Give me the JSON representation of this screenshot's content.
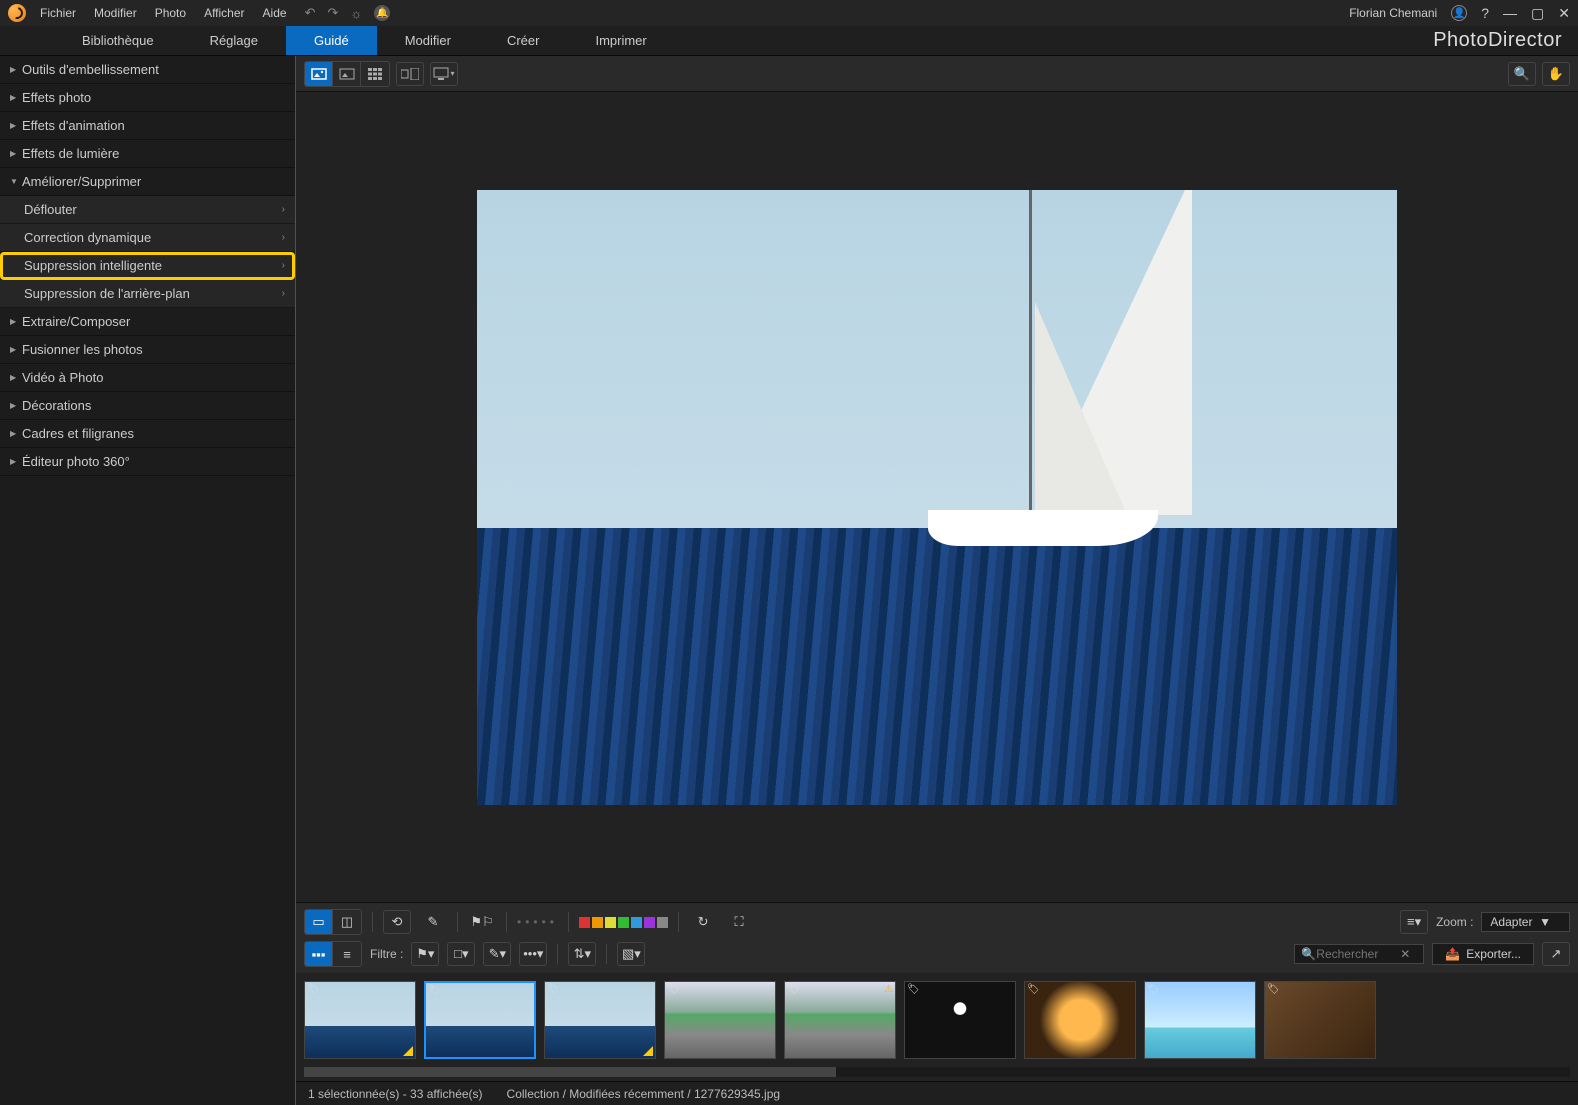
{
  "app": {
    "brand": "PhotoDirector"
  },
  "menubar": [
    "Fichier",
    "Modifier",
    "Photo",
    "Afficher",
    "Aide"
  ],
  "user": {
    "name": "Florian Chemani"
  },
  "tabs": [
    {
      "label": "Bibliothèque",
      "active": false
    },
    {
      "label": "Réglage",
      "active": false
    },
    {
      "label": "Guidé",
      "active": true
    },
    {
      "label": "Modifier",
      "active": false
    },
    {
      "label": "Créer",
      "active": false
    },
    {
      "label": "Imprimer",
      "active": false
    }
  ],
  "sidebar": [
    {
      "label": "Outils d'embellissement",
      "expanded": false
    },
    {
      "label": "Effets photo",
      "expanded": false
    },
    {
      "label": "Effets d'animation",
      "expanded": false
    },
    {
      "label": "Effets de lumière",
      "expanded": false
    },
    {
      "label": "Améliorer/Supprimer",
      "expanded": true,
      "children": [
        {
          "label": "Déflouter"
        },
        {
          "label": "Correction dynamique"
        },
        {
          "label": "Suppression intelligente",
          "highlight": true
        },
        {
          "label": "Suppression de l'arrière-plan"
        }
      ]
    },
    {
      "label": "Extraire/Composer",
      "expanded": false
    },
    {
      "label": "Fusionner les photos",
      "expanded": false
    },
    {
      "label": "Vidéo à Photo",
      "expanded": false
    },
    {
      "label": "Décorations",
      "expanded": false
    },
    {
      "label": "Cadres et filigranes",
      "expanded": false
    },
    {
      "label": "Éditeur photo 360°",
      "expanded": false
    }
  ],
  "lower": {
    "filter_label": "Filtre :",
    "zoom_label": "Zoom :",
    "zoom_value": "Adapter",
    "search_placeholder": "Rechercher",
    "export_label": "Exporter..."
  },
  "swatches": [
    "#d33",
    "#e90",
    "#dd3",
    "#3b3",
    "#39d",
    "#93d",
    "#888"
  ],
  "status": {
    "selection": "1 sélectionnée(s) - 33 affichée(s)",
    "path": "Collection / Modifiées récemment / 1277629345.jpg"
  },
  "thumbnails": [
    {
      "type": "boat",
      "selected": false,
      "corner": true
    },
    {
      "type": "boat",
      "selected": true
    },
    {
      "type": "boat",
      "selected": false,
      "corner": true,
      "stack": true
    },
    {
      "type": "road",
      "selected": false
    },
    {
      "type": "road",
      "selected": false,
      "warn": true
    },
    {
      "type": "mask",
      "selected": false
    },
    {
      "type": "room",
      "selected": false
    },
    {
      "type": "beach",
      "selected": false
    },
    {
      "type": "interior",
      "selected": false
    }
  ]
}
